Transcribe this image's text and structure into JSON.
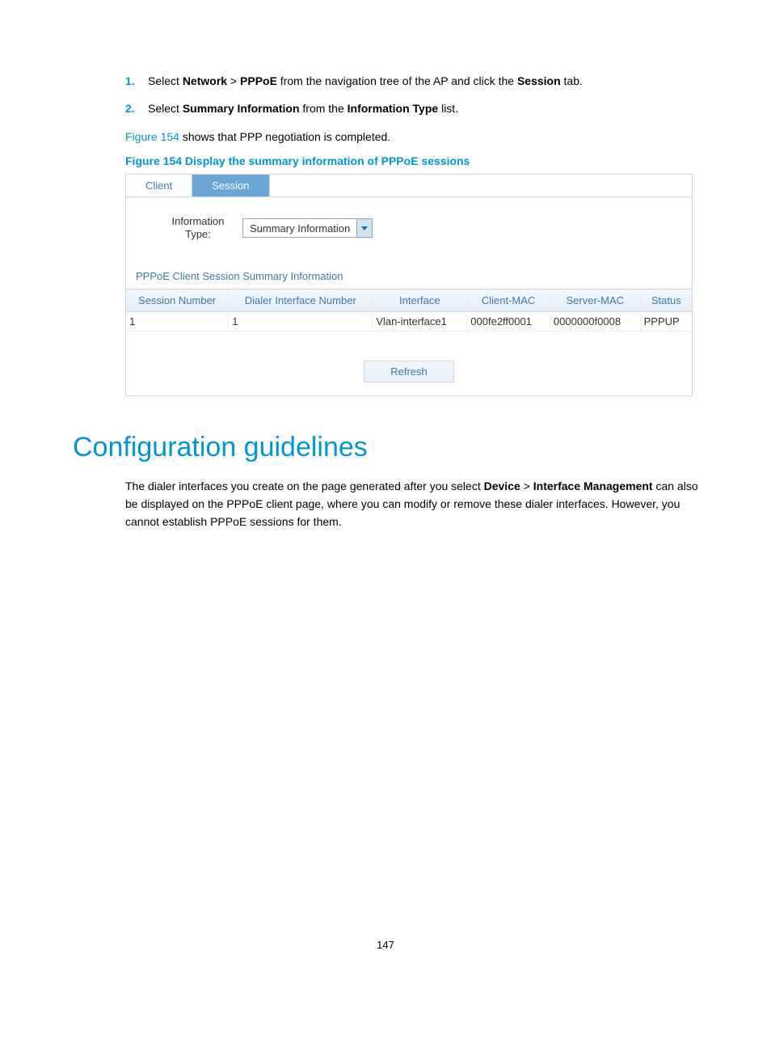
{
  "steps": [
    {
      "num": "1.",
      "parts": [
        "Select ",
        "Network",
        " > ",
        "PPPoE",
        " from the navigation tree of the AP and click the ",
        "Session",
        " tab."
      ]
    },
    {
      "num": "2.",
      "parts": [
        "Select ",
        "Summary Information",
        " from the ",
        "Information Type",
        " list."
      ]
    }
  ],
  "figref_sentence": {
    "link": "Figure 154",
    "rest": " shows that PPP negotiation is completed."
  },
  "fig_caption": "Figure 154 Display the summary information of PPPoE sessions",
  "app": {
    "tabs": {
      "client": "Client",
      "session": "Session"
    },
    "info_label": "Information Type:",
    "select_value": "Summary Information",
    "section_title": "PPPoE Client Session Summary Information",
    "columns": [
      "Session Number",
      "Dialer Interface Number",
      "Interface",
      "Client-MAC",
      "Server-MAC",
      "Status"
    ],
    "rows": [
      {
        "session": "1",
        "dialer": "1",
        "iface": "Vlan-interface1",
        "cmac": "000fe2ff0001",
        "smac": "0000000f0008",
        "status": "PPPUP"
      }
    ],
    "refresh": "Refresh"
  },
  "heading": "Configuration guidelines",
  "guidelines_para": {
    "p1a": "The dialer interfaces you create on the page generated after you select ",
    "p1b": "Device",
    "p1c": " > ",
    "p1d": "Interface Management",
    "p2": " can also be displayed on the PPPoE client page, where you can modify or remove these dialer interfaces. However, you cannot establish PPPoE sessions for them."
  },
  "pagenum": "147"
}
